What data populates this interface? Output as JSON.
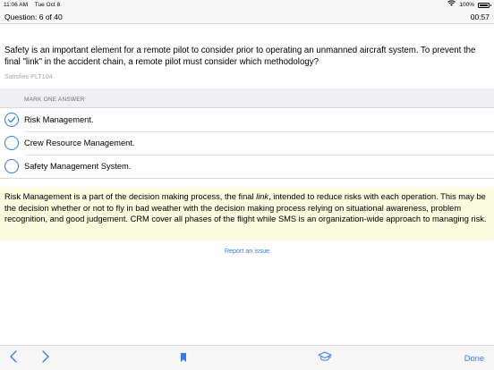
{
  "status_bar": {
    "time": "11:06 AM",
    "date": "Tue Oct 8",
    "battery": "100%"
  },
  "header": {
    "question_number": "Question: 6 of 40",
    "timer": "00:57"
  },
  "question": {
    "text": "Safety is an important element for a remote pilot to consider prior to operating an unmanned aircraft system. To prevent the final \"link\" in the accident chain, a remote pilot must consider which methodology?",
    "satisfies": "Satisfies PLT104"
  },
  "answers": {
    "section_label": "MARK ONE ANSWER",
    "options": [
      {
        "label": "Risk Management.",
        "selected": true
      },
      {
        "label": "Crew Resource Management.",
        "selected": false
      },
      {
        "label": "Safety Management System.",
        "selected": false
      }
    ]
  },
  "explanation": {
    "text_before": "Risk Management is a part of the decision making process, the final ",
    "emphasis": "link",
    "text_after": ", intended to reduce risks with each operation. This may be the decision whether or not to fly in bad weather with the decision making process relying on situational awareness, problem recognition, and good judgement. CRM cover all phases of the flight while SMS is an organization-wide approach to managing risk."
  },
  "report_link": "Report an issue",
  "toolbar": {
    "done_label": "Done",
    "icons": [
      "chevron-left-icon",
      "chevron-right-icon",
      "bookmark-icon",
      "graduation-cap-icon"
    ]
  },
  "colors": {
    "accent": "#3478f6",
    "explanation_bg": "#fbfbe0",
    "grouped_bg": "#efeff4"
  }
}
